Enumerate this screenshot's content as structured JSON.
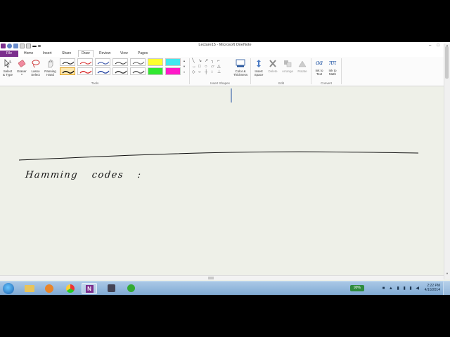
{
  "window": {
    "title": "Lecture15 - Microsoft OneNote",
    "controls": {
      "minimize": "–",
      "restore": "□",
      "close": "✕"
    }
  },
  "tabs": [
    {
      "label": "File"
    },
    {
      "label": "Home"
    },
    {
      "label": "Insert"
    },
    {
      "label": "Share"
    },
    {
      "label": "Draw"
    },
    {
      "label": "Review"
    },
    {
      "label": "View"
    },
    {
      "label": "Pages"
    }
  ],
  "active_tab": "Draw",
  "ribbon": {
    "select_type": {
      "line1": "Select",
      "line2": "& Type"
    },
    "eraser": {
      "line1": "Eraser",
      "line2": ""
    },
    "lasso": {
      "line1": "Lasso",
      "line2": "Select"
    },
    "panning": {
      "line1": "Panning",
      "line2": "Hand"
    },
    "color_thickness": {
      "line1": "Color &",
      "line2": "Thickness"
    },
    "insert_space": {
      "line1": "Insert",
      "line2": "Space"
    },
    "delete": {
      "line1": "Delete",
      "line2": ""
    },
    "arrange": {
      "line1": "Arrange",
      "line2": ""
    },
    "rotate": {
      "line1": "Rotate",
      "line2": ""
    },
    "ink_to_text": {
      "line1": "Ink to",
      "line2": "Text",
      "glyph": "a"
    },
    "ink_to_math": {
      "line1": "Ink to",
      "line2": "Math",
      "glyph": "π"
    },
    "groups": {
      "tools": "Tools",
      "insert_shapes": "Insert Shapes",
      "edit": "Edit",
      "convert": "Convert"
    },
    "pen_colors": [
      "#000000",
      "#d62020",
      "#1f3f9e",
      "#303030",
      "#555555",
      "#e8e800",
      "#28d8e0",
      "#000000",
      "#d62020",
      "#1f3f9e",
      "#303030",
      "#555555",
      "#2ee82e",
      "#ff10c8"
    ]
  },
  "page": {
    "handwritten_text": "Hamming codes :"
  },
  "taskbar": {
    "battery": "99%",
    "time": "2:22 PM",
    "date": "4/10/2014"
  }
}
